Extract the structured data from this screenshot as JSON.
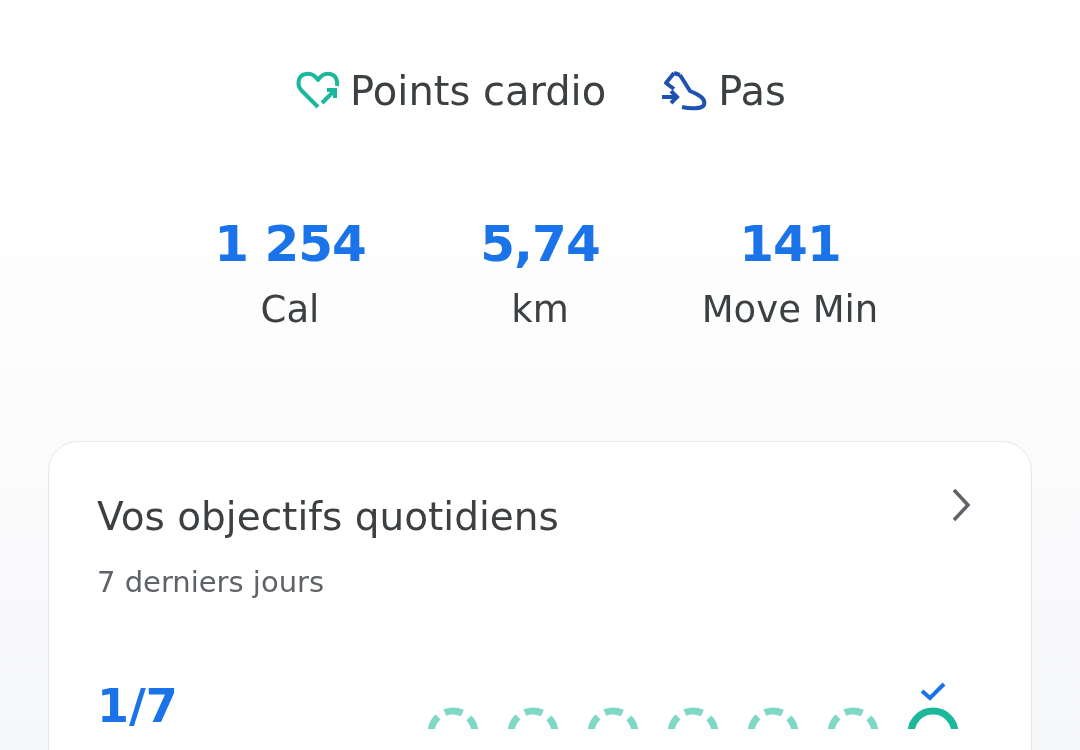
{
  "legend": [
    {
      "kind": "heart",
      "label": "Points cardio"
    },
    {
      "kind": "shoe",
      "label": "Pas"
    }
  ],
  "stats": [
    {
      "value": "1 254",
      "label": "Cal"
    },
    {
      "value": "5,74",
      "label": "km"
    },
    {
      "value": "141",
      "label": "Move Min"
    }
  ],
  "goals_card": {
    "title": "Vos objectifs quotidiens",
    "subtitle": "7 derniers jours",
    "count": "1/7",
    "days": [
      {
        "achieved": false
      },
      {
        "achieved": false
      },
      {
        "achieved": false
      },
      {
        "achieved": false
      },
      {
        "achieved": false
      },
      {
        "achieved": false
      },
      {
        "achieved": true
      }
    ]
  }
}
